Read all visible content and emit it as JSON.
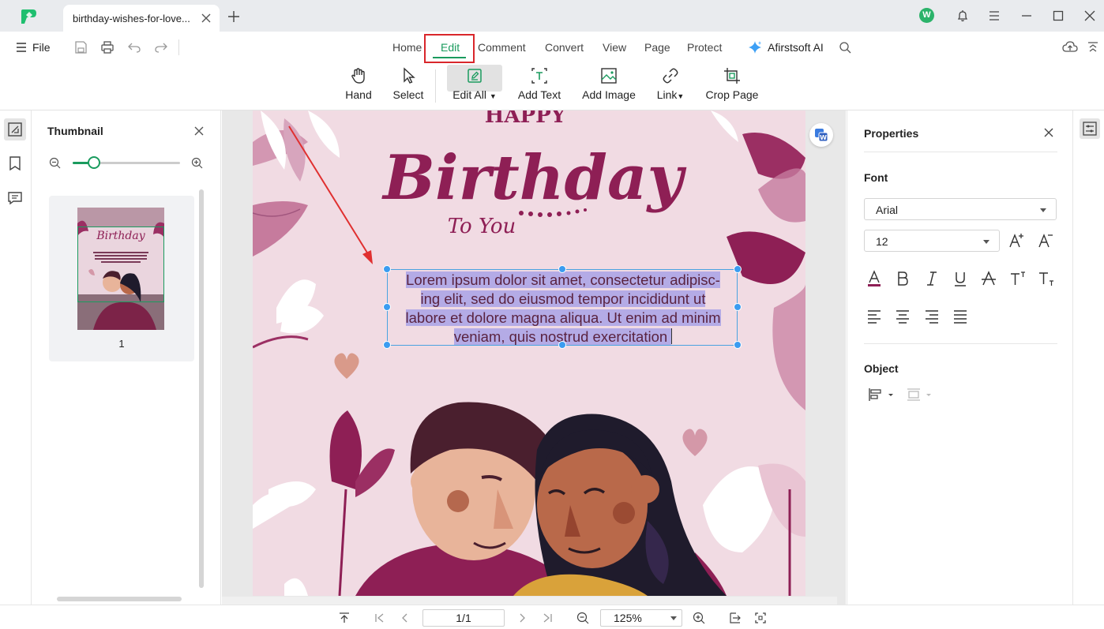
{
  "window": {
    "tab_title": "birthday-wishes-for-love...",
    "avatar_letter": "W"
  },
  "menubar": {
    "file_label": "File",
    "tabs": [
      "Home",
      "Edit",
      "Comment",
      "Convert",
      "View",
      "Page",
      "Protect"
    ],
    "active_tab": "Edit",
    "ai_label": "Afirstsoft AI"
  },
  "ribbon": {
    "buttons": [
      {
        "label": "Hand",
        "icon": "hand-icon"
      },
      {
        "label": "Select",
        "icon": "cursor-icon"
      },
      {
        "label": "Edit All",
        "icon": "edit-all-icon",
        "active": true,
        "dropdown": true
      },
      {
        "label": "Add Text",
        "icon": "add-text-icon"
      },
      {
        "label": "Add Image",
        "icon": "add-image-icon"
      },
      {
        "label": "Link",
        "icon": "link-icon",
        "dropdown": true
      },
      {
        "label": "Crop Page",
        "icon": "crop-icon"
      }
    ]
  },
  "thumbnail_panel": {
    "title": "Thumbnail",
    "page_number": "1",
    "zoom_level_fraction": 0.2
  },
  "document": {
    "heading_top": "HAPPY",
    "heading_main": "Birthday",
    "heading_sub": "To You",
    "text_lines": [
      "Lorem ipsum dolor sit amet, consectetur adipisc-",
      "ing elit, sed do eiusmod tempor incididunt ut",
      "labore et dolore magna aliqua. Ut enim ad minim",
      "veniam, quis nostrud exercitation "
    ]
  },
  "properties": {
    "title": "Properties",
    "font_section": "Font",
    "font_family": "Arial",
    "font_size": "12",
    "object_section": "Object"
  },
  "statusbar": {
    "page": "1/1",
    "zoom": "125%"
  },
  "colors": {
    "accent": "#1a9b5e",
    "highlight_box": "#d9262b",
    "page_bg": "#f1dbe3",
    "text_color": "#5a2340",
    "selection": "#b4abe6"
  }
}
